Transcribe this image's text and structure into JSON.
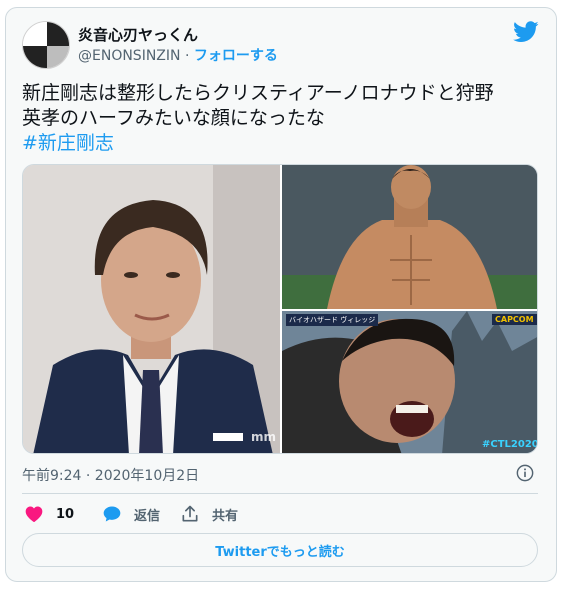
{
  "author": {
    "display_name": "炎音心刃ヤっくん",
    "handle": "@ENONSINZIN",
    "separator": " · ",
    "follow_label": "フォローする"
  },
  "tweet": {
    "text_lines": [
      "新庄剛志は整形したらクリスティアーノロナウドと狩野",
      "英孝のハーフみたいな顔になったな"
    ],
    "hashtag": "#新庄剛志"
  },
  "timestamp": "午前9:24 · 2020年10月2日",
  "actions": {
    "like_count": "10",
    "reply_label": "返信",
    "share_label": "共有"
  },
  "read_more_label": "Twitterでもっと読む",
  "image_overlays": {
    "watermark_left": "mm",
    "br_tag_top_left": "バイオハザード ヴィレッジ",
    "br_brand": "CAPCOM",
    "br_hashtag": "#CTL2020"
  },
  "colors": {
    "accent": "#1d9bf0",
    "like": "#f91880",
    "muted": "#536471",
    "text": "#0f1419",
    "border": "#cfd9de"
  },
  "icons": {
    "logo": "twitter-bird-icon",
    "like": "heart-icon",
    "reply": "speech-bubble-icon",
    "share": "share-icon",
    "info": "info-icon"
  }
}
